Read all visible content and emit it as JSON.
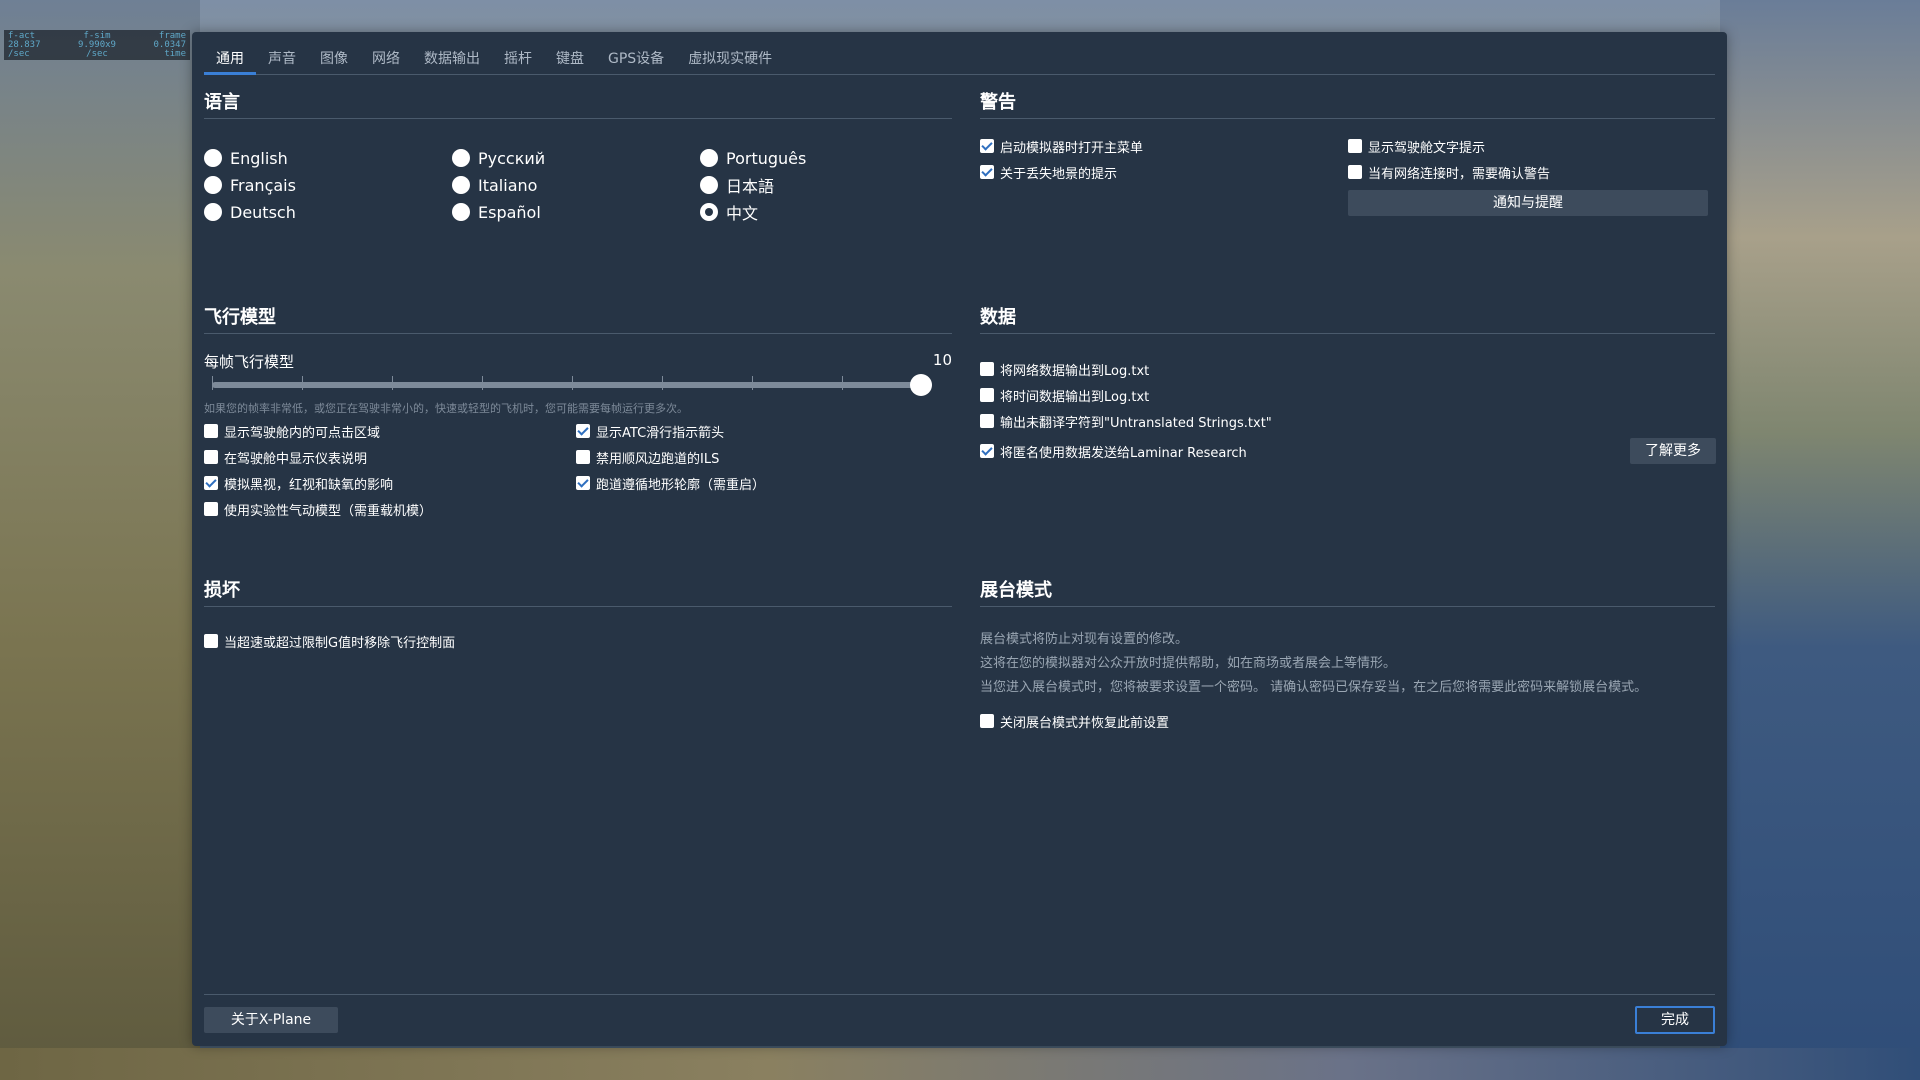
{
  "stats": {
    "headers": [
      "f-act",
      "f-sim",
      "frame"
    ],
    "values": [
      "28.837",
      "9.990x9",
      "0.0347"
    ],
    "units": [
      "/sec",
      "/sec",
      "time"
    ]
  },
  "tabs": [
    "通用",
    "声音",
    "图像",
    "网络",
    "数据输出",
    "摇杆",
    "键盘",
    "GPS设备",
    "虚拟现实硬件"
  ],
  "language": {
    "title": "语言",
    "options": [
      "English",
      "Français",
      "Deutsch",
      "Русский",
      "Italiano",
      "Español",
      "Português",
      "日本語",
      "中文"
    ],
    "selected": "中文"
  },
  "warnings": {
    "title": "警告",
    "items": [
      {
        "label": "启动模拟器时打开主菜单",
        "checked": true
      },
      {
        "label": "关于丢失地景的提示",
        "checked": true
      },
      {
        "label": "显示驾驶舱文字提示",
        "checked": false
      },
      {
        "label": "当有网络连接时，需要确认警告",
        "checked": false
      }
    ],
    "notify_button": "通知与提醒"
  },
  "flight_model": {
    "title": "飞行模型",
    "slider_label": "每帧飞行模型",
    "slider_value": "10",
    "slider_fraction": 1.0,
    "hint": "如果您的帧率非常低，或您正在驾驶非常小的，快速或轻型的飞机时，您可能需要每帧运行更多次。",
    "items": [
      {
        "label": "显示驾驶舱内的可点击区域",
        "checked": false
      },
      {
        "label": "在驾驶舱中显示仪表说明",
        "checked": false
      },
      {
        "label": "模拟黑视，红视和缺氧的影响",
        "checked": true
      },
      {
        "label": "使用实验性气动模型（需重载机模）",
        "checked": false
      },
      {
        "label": "显示ATC滑行指示箭头",
        "checked": true
      },
      {
        "label": "禁用顺风边跑道的ILS",
        "checked": false
      },
      {
        "label": "跑道遵循地形轮廓（需重启）",
        "checked": true
      }
    ]
  },
  "data": {
    "title": "数据",
    "items": [
      {
        "label": "将网络数据输出到Log.txt",
        "checked": false
      },
      {
        "label": "将时间数据输出到Log.txt",
        "checked": false
      },
      {
        "label": "输出未翻译字符到\"Untranslated Strings.txt\"",
        "checked": false
      },
      {
        "label": "将匿名使用数据发送给Laminar Research",
        "checked": true
      }
    ],
    "learn_more": "了解更多"
  },
  "damage": {
    "title": "损坏",
    "items": [
      {
        "label": "当超速或超过限制G值时移除飞行控制面",
        "checked": false
      }
    ]
  },
  "kiosk": {
    "title": "展台模式",
    "lines": [
      "展台模式将防止对现有设置的修改。",
      "这将在您的模拟器对公众开放时提供帮助，如在商场或者展会上等情形。",
      "当您进入展台模式时，您将被要求设置一个密码。 请确认密码已保存妥当，在之后您将需要此密码来解锁展台模式。"
    ],
    "items": [
      {
        "label": "关闭展台模式并恢复此前设置",
        "checked": false
      }
    ]
  },
  "footer": {
    "about": "关于X-Plane",
    "done": "完成"
  },
  "colors": {
    "dialog_bg": "#263445",
    "accent": "#3a7fd6",
    "button_bg": "#3d4b5c"
  }
}
